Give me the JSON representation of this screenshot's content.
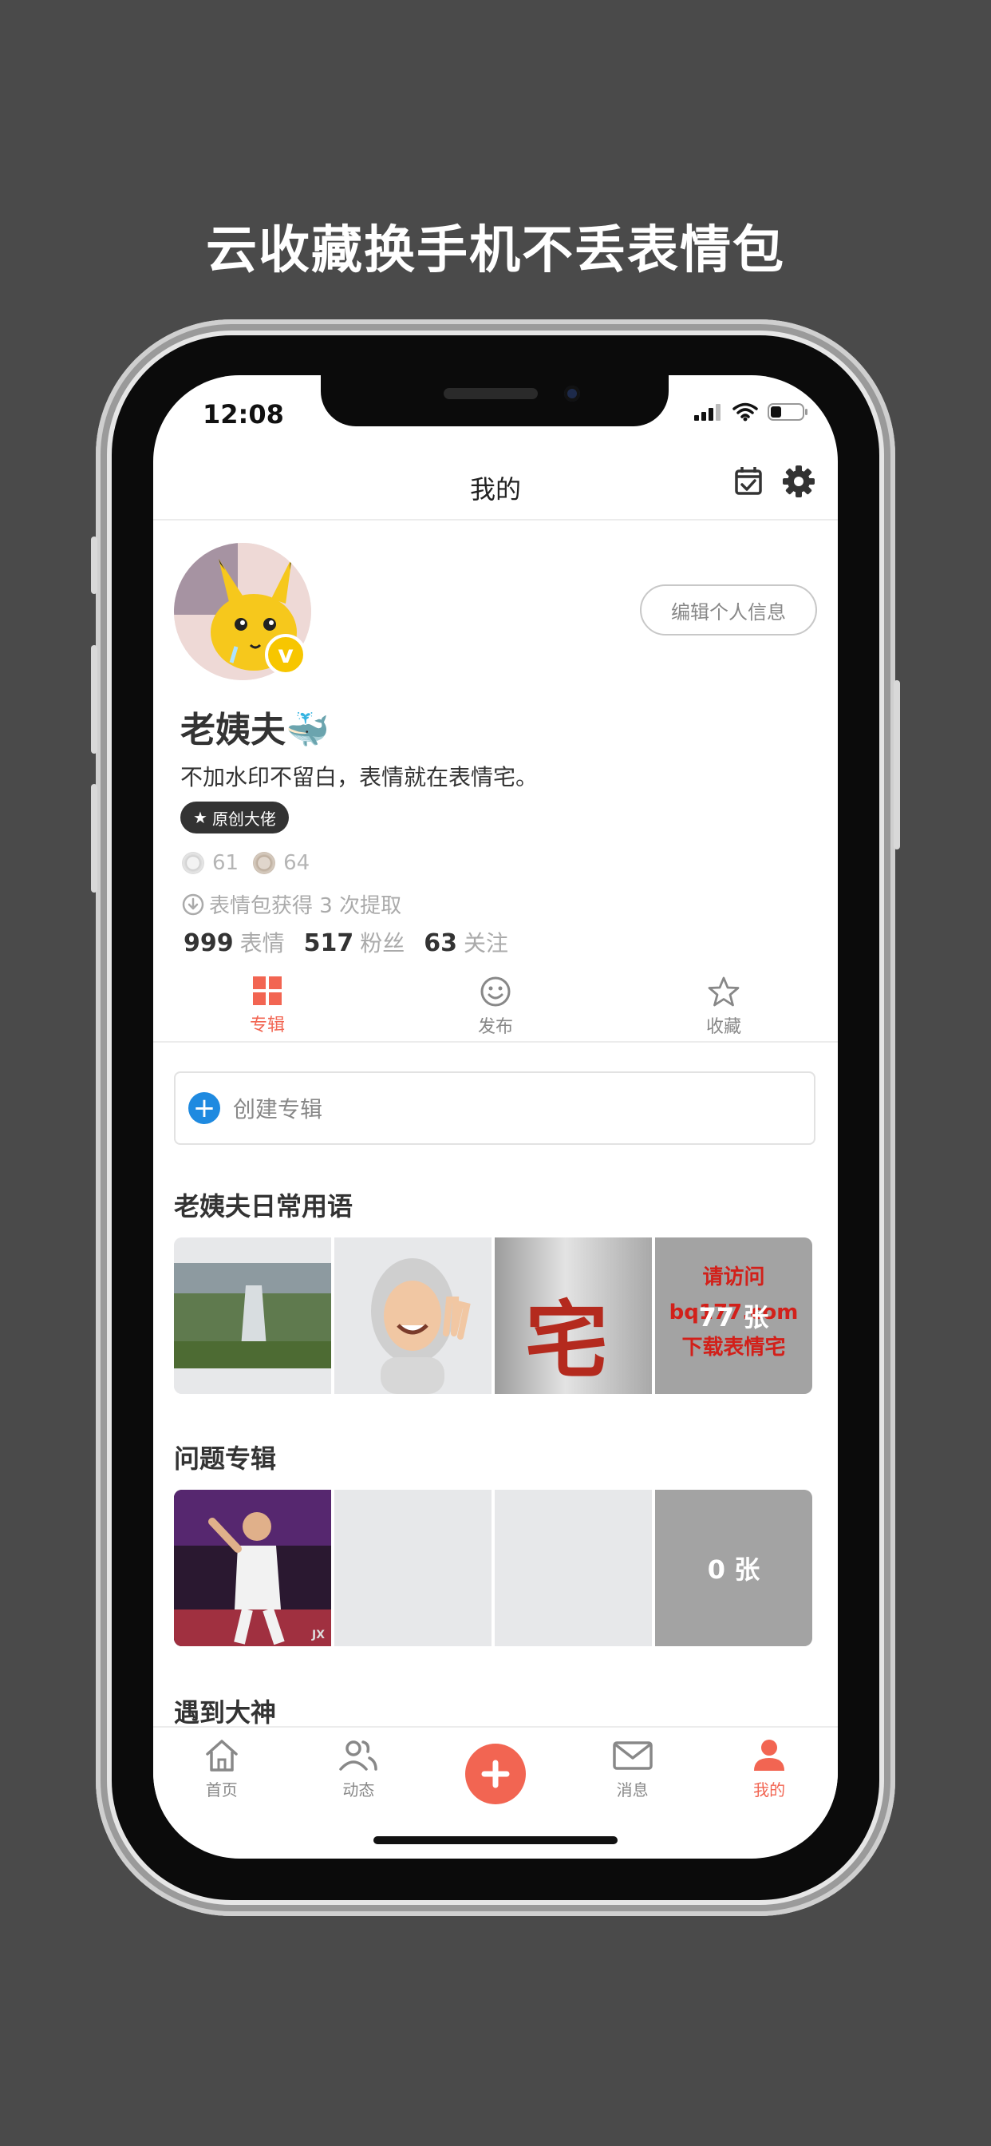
{
  "promo": {
    "headline": "云收藏换手机不丢表情包"
  },
  "status_bar": {
    "time": "12:08"
  },
  "nav": {
    "title": "我的",
    "icons": [
      "calendar-check-icon",
      "gear-icon"
    ]
  },
  "profile": {
    "edit_label": "编辑个人信息",
    "verified_badge": "v",
    "username": "老姨夫🐳",
    "bio": "不加水印不留白，表情就在表情宅。",
    "tag": "原创大佬",
    "coin1": "61",
    "coin2": "64",
    "extract_text": "表情包获得 3 次提取",
    "stats": [
      {
        "num": "999",
        "label": "表情"
      },
      {
        "num": "517",
        "label": "粉丝"
      },
      {
        "num": "63",
        "label": "关注"
      }
    ]
  },
  "tabs": [
    {
      "label": "专辑",
      "active": true
    },
    {
      "label": "发布",
      "active": false
    },
    {
      "label": "收藏",
      "active": false
    }
  ],
  "create_album": {
    "label": "创建专辑"
  },
  "albums": [
    {
      "title": "老姨夫日常用语",
      "count": "77 张",
      "overlay_text": [
        "请访问",
        "bq177.com",
        "下载表情宅"
      ],
      "partial_text": "宅"
    },
    {
      "title": "问题专辑",
      "count": "0 张",
      "watermark": "JX"
    },
    {
      "title": "遇到大神"
    }
  ],
  "tabbar": [
    {
      "label": "首页",
      "active": false
    },
    {
      "label": "动态",
      "active": false
    },
    {
      "label": "",
      "active": false
    },
    {
      "label": "消息",
      "active": false
    },
    {
      "label": "我的",
      "active": true
    }
  ],
  "colors": {
    "accent": "#f26552",
    "blue": "#1f8ae0",
    "background": "#4a4a4a"
  }
}
